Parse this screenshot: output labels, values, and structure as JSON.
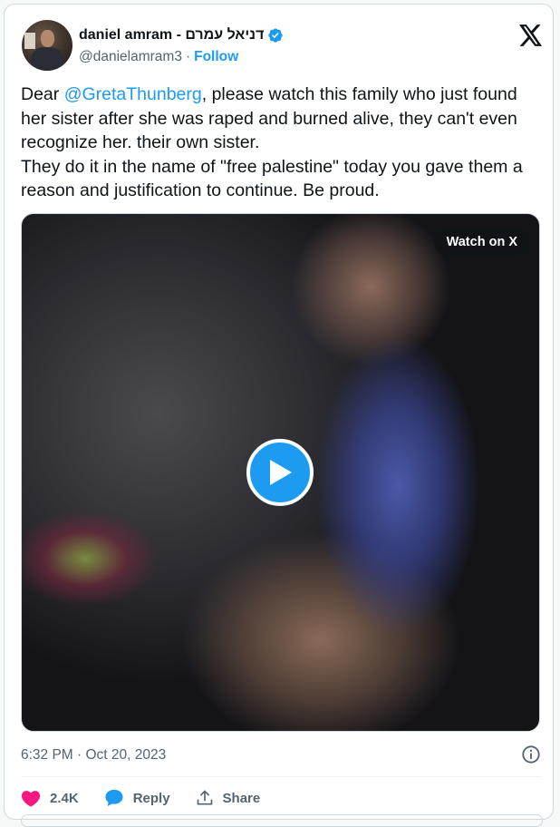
{
  "author": {
    "display_name": "daniel amram - דניאל עמרם",
    "handle": "@danielamram3",
    "follow_label": "Follow",
    "verified_color": "#1d9bf0"
  },
  "tweet": {
    "text_before_mention": "Dear ",
    "mention": "@GretaThunberg",
    "text_after_mention": ", please watch this family who just found her sister after she was raped and burned alive, they can't even recognize her. their own sister.\nThey do it in the name of \"free palestine\" today you gave them a reason and justification to continue. Be proud."
  },
  "media": {
    "watch_label": "Watch on X",
    "play_icon": "play-icon"
  },
  "meta": {
    "timestamp": "6:32 PM · Oct 20, 2023"
  },
  "actions": {
    "likes": "2.4K",
    "reply_label": "Reply",
    "share_label": "Share"
  },
  "colors": {
    "accent": "#1d9bf0",
    "like": "#f91880",
    "text": "#0f1419",
    "muted": "#536471"
  }
}
